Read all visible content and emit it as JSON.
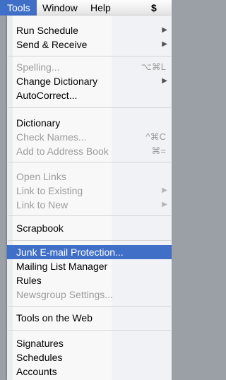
{
  "menubar": {
    "items": [
      {
        "label": "Tools"
      },
      {
        "label": "Window"
      },
      {
        "label": "Help"
      },
      {
        "label": "$"
      }
    ]
  },
  "menu": {
    "items": [
      {
        "label": "Run Schedule",
        "state": "enabled",
        "submenu": true
      },
      {
        "label": "Send & Receive",
        "state": "enabled",
        "submenu": true
      },
      {
        "label": "Spelling...",
        "state": "disabled",
        "shortcut": "⌥⌘L"
      },
      {
        "label": "Change Dictionary",
        "state": "enabled",
        "submenu": true
      },
      {
        "label": "AutoCorrect...",
        "state": "enabled"
      },
      {
        "label": "Dictionary",
        "state": "enabled"
      },
      {
        "label": "Check Names...",
        "state": "disabled",
        "shortcut": "^⌘C"
      },
      {
        "label": "Add to Address Book",
        "state": "disabled",
        "shortcut": "⌘="
      },
      {
        "label": "Open Links",
        "state": "disabled"
      },
      {
        "label": "Link to Existing",
        "state": "disabled",
        "submenu": true
      },
      {
        "label": "Link to New",
        "state": "disabled",
        "submenu": true
      },
      {
        "label": "Scrapbook",
        "state": "enabled"
      },
      {
        "label": "Junk E-mail Protection...",
        "state": "highlighted"
      },
      {
        "label": "Mailing List Manager",
        "state": "enabled"
      },
      {
        "label": "Rules",
        "state": "enabled"
      },
      {
        "label": "Newsgroup Settings...",
        "state": "disabled"
      },
      {
        "label": "Tools on the Web",
        "state": "enabled"
      },
      {
        "label": "Signatures",
        "state": "enabled"
      },
      {
        "label": "Schedules",
        "state": "enabled"
      },
      {
        "label": "Accounts",
        "state": "enabled"
      }
    ]
  },
  "colors": {
    "highlight": "#3f6fc6",
    "disabled_text": "#9c9c9c"
  }
}
